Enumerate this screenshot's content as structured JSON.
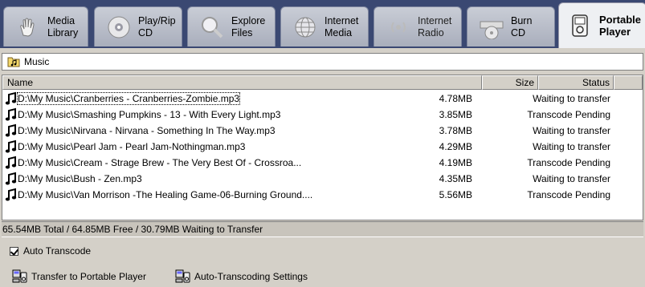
{
  "tabs": [
    {
      "id": "media-library",
      "line1": "Media",
      "line2": "Library",
      "icon": "hand-icon"
    },
    {
      "id": "play-rip-cd",
      "line1": "Play/Rip",
      "line2": "CD",
      "icon": "cd-icon"
    },
    {
      "id": "explore-files",
      "line1": "Explore",
      "line2": "Files",
      "icon": "magnifier-icon"
    },
    {
      "id": "internet-media",
      "line1": "Internet",
      "line2": "Media",
      "icon": "globe-icon"
    },
    {
      "id": "internet-radio",
      "line1": "Internet",
      "line2": "Radio",
      "icon": "radio-waves-icon"
    },
    {
      "id": "burn-cd",
      "line1": "Burn",
      "line2": "CD",
      "icon": "burner-icon"
    },
    {
      "id": "portable-player",
      "line1": "Portable",
      "line2": "Player",
      "icon": "portable-player-icon",
      "active": true
    }
  ],
  "folder": {
    "label": "Music",
    "icon": "music-folder-icon"
  },
  "columns": {
    "name": "Name",
    "size": "Size",
    "status": "Status"
  },
  "rows": [
    {
      "name": "D:\\My Music\\Cranberries - Cranberries-Zombie.mp3",
      "size": "4.78MB",
      "status": "Waiting to transfer"
    },
    {
      "name": "D:\\My Music\\Smashing Pumpkins - 13 - With Every Light.mp3",
      "size": "3.85MB",
      "status": "Transcode Pending"
    },
    {
      "name": "D:\\My Music\\Nirvana - Nirvana - Something In The Way.mp3",
      "size": "3.78MB",
      "status": "Waiting to transfer"
    },
    {
      "name": "D:\\My Music\\Pearl Jam - Pearl Jam-Nothingman.mp3",
      "size": "4.29MB",
      "status": "Waiting to transfer"
    },
    {
      "name": "D:\\My Music\\Cream - Strage Brew - The Very Best Of - Crossroa...",
      "size": "4.19MB",
      "status": "Transcode Pending"
    },
    {
      "name": "D:\\My Music\\Bush - Zen.mp3",
      "size": "4.35MB",
      "status": "Waiting to transfer"
    },
    {
      "name": "D:\\My Music\\Van Morrison -The Healing Game-06-Burning Ground....",
      "size": "5.56MB",
      "status": "Transcode Pending"
    }
  ],
  "status_bar": "65.54MB Total / 64.85MB Free / 30.79MB Waiting to Transfer",
  "auto_transcode": {
    "label": "Auto Transcode",
    "checked": true
  },
  "buttons": {
    "transfer": "Transfer to Portable Player",
    "settings": "Auto-Transcoding Settings"
  }
}
